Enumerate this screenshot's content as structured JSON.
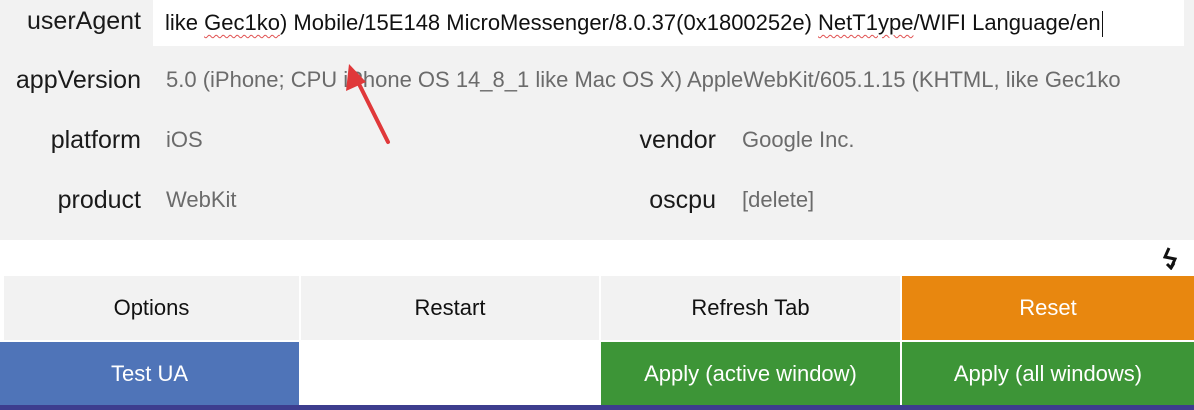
{
  "fields": {
    "userAgent": {
      "label": "userAgent",
      "value_prefix": "like ",
      "value_mis1": "Gec1ko",
      "value_mid": ") Mobile/15E148 MicroMessenger/8.0.37(0x1800252e) ",
      "value_mis2": "NetT1ype",
      "value_suffix": "/WIFI Language/en"
    },
    "appVersion": {
      "label": "appVersion",
      "value": "5.0 (iPhone; CPU iPhone OS 14_8_1 like Mac OS X) AppleWebKit/605.1.15 (KHTML, like Gec1ko"
    },
    "platform": {
      "label": "platform",
      "value": "iOS"
    },
    "vendor": {
      "label": "vendor",
      "value": "Google Inc."
    },
    "product": {
      "label": "product",
      "value": "WebKit"
    },
    "oscpu": {
      "label": "oscpu",
      "value": "[delete]"
    }
  },
  "buttons": {
    "options": "Options",
    "restart": "Restart",
    "refresh_tab": "Refresh Tab",
    "reset": "Reset",
    "test_ua": "Test UA",
    "apply_active": "Apply (active window)",
    "apply_all": "Apply (all windows)"
  },
  "icons": {
    "annotation": "red-arrow-icon",
    "corner": "lightning-icon"
  },
  "colors": {
    "panel_bg": "#f2f2f2",
    "reset": "#e8870f",
    "test_ua": "#4f74b8",
    "apply": "#3d9537",
    "arrow": "#e0383a"
  }
}
